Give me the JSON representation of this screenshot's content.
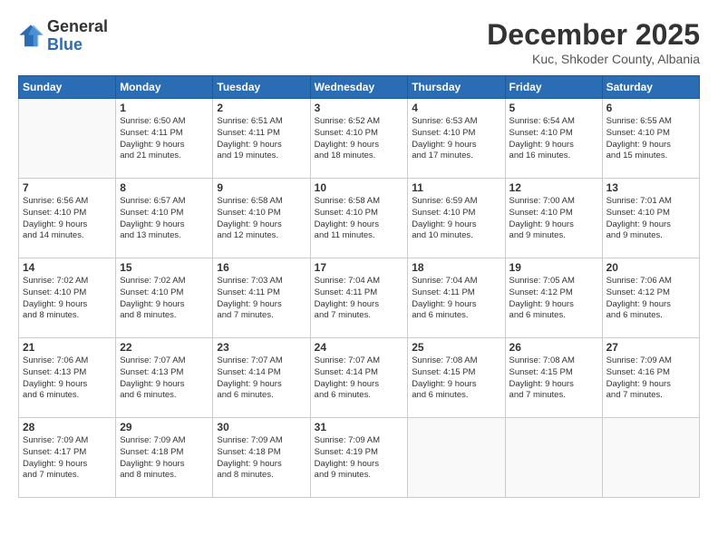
{
  "logo": {
    "general": "General",
    "blue": "Blue"
  },
  "title": "December 2025",
  "subtitle": "Kuc, Shkoder County, Albania",
  "days_of_week": [
    "Sunday",
    "Monday",
    "Tuesday",
    "Wednesday",
    "Thursday",
    "Friday",
    "Saturday"
  ],
  "weeks": [
    [
      {
        "date": "",
        "info": ""
      },
      {
        "date": "1",
        "info": "Sunrise: 6:50 AM\nSunset: 4:11 PM\nDaylight: 9 hours\nand 21 minutes."
      },
      {
        "date": "2",
        "info": "Sunrise: 6:51 AM\nSunset: 4:11 PM\nDaylight: 9 hours\nand 19 minutes."
      },
      {
        "date": "3",
        "info": "Sunrise: 6:52 AM\nSunset: 4:10 PM\nDaylight: 9 hours\nand 18 minutes."
      },
      {
        "date": "4",
        "info": "Sunrise: 6:53 AM\nSunset: 4:10 PM\nDaylight: 9 hours\nand 17 minutes."
      },
      {
        "date": "5",
        "info": "Sunrise: 6:54 AM\nSunset: 4:10 PM\nDaylight: 9 hours\nand 16 minutes."
      },
      {
        "date": "6",
        "info": "Sunrise: 6:55 AM\nSunset: 4:10 PM\nDaylight: 9 hours\nand 15 minutes."
      }
    ],
    [
      {
        "date": "7",
        "info": "Sunrise: 6:56 AM\nSunset: 4:10 PM\nDaylight: 9 hours\nand 14 minutes."
      },
      {
        "date": "8",
        "info": "Sunrise: 6:57 AM\nSunset: 4:10 PM\nDaylight: 9 hours\nand 13 minutes."
      },
      {
        "date": "9",
        "info": "Sunrise: 6:58 AM\nSunset: 4:10 PM\nDaylight: 9 hours\nand 12 minutes."
      },
      {
        "date": "10",
        "info": "Sunrise: 6:58 AM\nSunset: 4:10 PM\nDaylight: 9 hours\nand 11 minutes."
      },
      {
        "date": "11",
        "info": "Sunrise: 6:59 AM\nSunset: 4:10 PM\nDaylight: 9 hours\nand 10 minutes."
      },
      {
        "date": "12",
        "info": "Sunrise: 7:00 AM\nSunset: 4:10 PM\nDaylight: 9 hours\nand 9 minutes."
      },
      {
        "date": "13",
        "info": "Sunrise: 7:01 AM\nSunset: 4:10 PM\nDaylight: 9 hours\nand 9 minutes."
      }
    ],
    [
      {
        "date": "14",
        "info": "Sunrise: 7:02 AM\nSunset: 4:10 PM\nDaylight: 9 hours\nand 8 minutes."
      },
      {
        "date": "15",
        "info": "Sunrise: 7:02 AM\nSunset: 4:10 PM\nDaylight: 9 hours\nand 8 minutes."
      },
      {
        "date": "16",
        "info": "Sunrise: 7:03 AM\nSunset: 4:11 PM\nDaylight: 9 hours\nand 7 minutes."
      },
      {
        "date": "17",
        "info": "Sunrise: 7:04 AM\nSunset: 4:11 PM\nDaylight: 9 hours\nand 7 minutes."
      },
      {
        "date": "18",
        "info": "Sunrise: 7:04 AM\nSunset: 4:11 PM\nDaylight: 9 hours\nand 6 minutes."
      },
      {
        "date": "19",
        "info": "Sunrise: 7:05 AM\nSunset: 4:12 PM\nDaylight: 9 hours\nand 6 minutes."
      },
      {
        "date": "20",
        "info": "Sunrise: 7:06 AM\nSunset: 4:12 PM\nDaylight: 9 hours\nand 6 minutes."
      }
    ],
    [
      {
        "date": "21",
        "info": "Sunrise: 7:06 AM\nSunset: 4:13 PM\nDaylight: 9 hours\nand 6 minutes."
      },
      {
        "date": "22",
        "info": "Sunrise: 7:07 AM\nSunset: 4:13 PM\nDaylight: 9 hours\nand 6 minutes."
      },
      {
        "date": "23",
        "info": "Sunrise: 7:07 AM\nSunset: 4:14 PM\nDaylight: 9 hours\nand 6 minutes."
      },
      {
        "date": "24",
        "info": "Sunrise: 7:07 AM\nSunset: 4:14 PM\nDaylight: 9 hours\nand 6 minutes."
      },
      {
        "date": "25",
        "info": "Sunrise: 7:08 AM\nSunset: 4:15 PM\nDaylight: 9 hours\nand 6 minutes."
      },
      {
        "date": "26",
        "info": "Sunrise: 7:08 AM\nSunset: 4:15 PM\nDaylight: 9 hours\nand 7 minutes."
      },
      {
        "date": "27",
        "info": "Sunrise: 7:09 AM\nSunset: 4:16 PM\nDaylight: 9 hours\nand 7 minutes."
      }
    ],
    [
      {
        "date": "28",
        "info": "Sunrise: 7:09 AM\nSunset: 4:17 PM\nDaylight: 9 hours\nand 7 minutes."
      },
      {
        "date": "29",
        "info": "Sunrise: 7:09 AM\nSunset: 4:18 PM\nDaylight: 9 hours\nand 8 minutes."
      },
      {
        "date": "30",
        "info": "Sunrise: 7:09 AM\nSunset: 4:18 PM\nDaylight: 9 hours\nand 8 minutes."
      },
      {
        "date": "31",
        "info": "Sunrise: 7:09 AM\nSunset: 4:19 PM\nDaylight: 9 hours\nand 9 minutes."
      },
      {
        "date": "",
        "info": ""
      },
      {
        "date": "",
        "info": ""
      },
      {
        "date": "",
        "info": ""
      }
    ]
  ]
}
